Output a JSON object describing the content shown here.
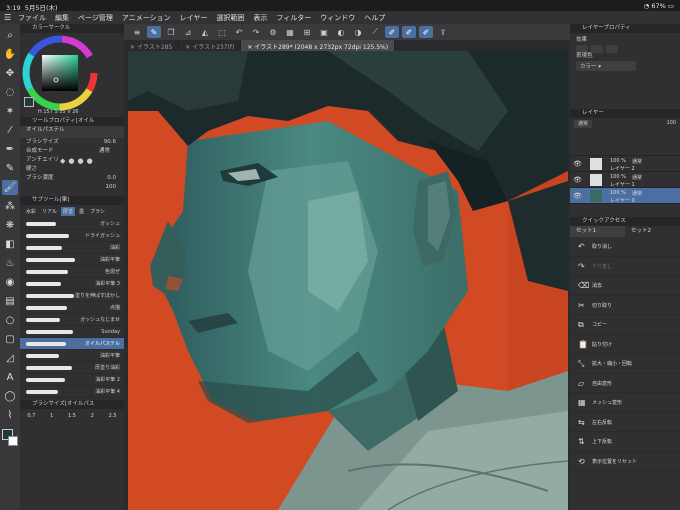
{
  "status": {
    "time": "3:19",
    "date": "5月5日(木)",
    "battery": "67%"
  },
  "menu": [
    "ファイル",
    "編集",
    "ページ管理",
    "アニメーション",
    "レイヤー",
    "選択範囲",
    "表示",
    "フィルター",
    "ウィンドウ",
    "ヘルプ"
  ],
  "tabs": [
    "イラスト285",
    "イラスト237(f)",
    "イラスト289* (2048 x 2732px 72dpi 125.5%)"
  ],
  "color_circle": {
    "title": "カラーサークル",
    "h": "157",
    "s": "35",
    "v": "26"
  },
  "tool_property": {
    "title": "ツールプロパティ[オイル",
    "tool": "オイルパステル",
    "brush_size_label": "ブラシサイズ",
    "brush_size": "90.6",
    "composite_label": "合成モード",
    "composite_value": "通常",
    "anti_alias": "アンチエイリ",
    "hardness": "硬さ",
    "blend_label": "ブラシ濃度",
    "blend": "0.0",
    "blend_max": "100"
  },
  "subtool": {
    "title": "サブツール[筆]",
    "tabs": [
      "水彩",
      "リアル",
      "厚塗",
      "墨",
      "ブラシ"
    ],
    "brushes": [
      "ガッシュ",
      "ドライガッシュ",
      "油彩",
      "油彩平筆",
      "色混ぜ",
      "油彩平筆 3",
      "塗りを伸ばすぼかし",
      "点描",
      "ガッシュなじませ",
      "Sunday",
      "オイルパステル",
      "油彩平筆",
      "厚塗り油彩",
      "油彩平筆 2",
      "油彩平筆 4"
    ],
    "selected": "オイルパステル"
  },
  "brush_size_palette": {
    "title": "ブラシサイズ[オイルパス",
    "sizes": [
      "0.7",
      "1",
      "1.5",
      "2",
      "2.5"
    ]
  },
  "layer_property": {
    "title": "レイヤープロパティ",
    "effect_label": "効果",
    "express_label": "表現色",
    "express_value": "カラー"
  },
  "layer_panel": {
    "title": "レイヤー",
    "blend": "通常",
    "opacity": "100",
    "layers": [
      {
        "pct": "100 %",
        "mode": "通常",
        "name": "レイヤー 2"
      },
      {
        "pct": "100 %",
        "mode": "通常",
        "name": "レイヤー 1"
      },
      {
        "pct": "100 %",
        "mode": "通常",
        "name": "レイヤー 0"
      }
    ]
  },
  "quick_access": {
    "title": "クイックアクセス",
    "tabs": [
      "セット1",
      "セット2"
    ],
    "items": [
      {
        "label": "取り消し",
        "icon": "↶"
      },
      {
        "label": "やり直し",
        "icon": "↷"
      },
      {
        "label": "消去",
        "icon": "⌫"
      },
      {
        "label": "切り取り",
        "icon": "✂"
      },
      {
        "label": "コピー",
        "icon": "⧉"
      },
      {
        "label": "貼り付け",
        "icon": "📋"
      },
      {
        "label": "拡大・縮小・回転",
        "icon": "⤡"
      },
      {
        "label": "自由変形",
        "icon": "▱"
      },
      {
        "label": "メッシュ変形",
        "icon": "▦"
      },
      {
        "label": "左右反転",
        "icon": "⇆"
      },
      {
        "label": "上下反転",
        "icon": "⇅"
      },
      {
        "label": "表示位置をリセット",
        "icon": "⟲"
      }
    ]
  },
  "colors": {
    "accent": "#4b6fa0",
    "canvas_bg": "#d24a23",
    "main_color": "#1f3a3a"
  }
}
